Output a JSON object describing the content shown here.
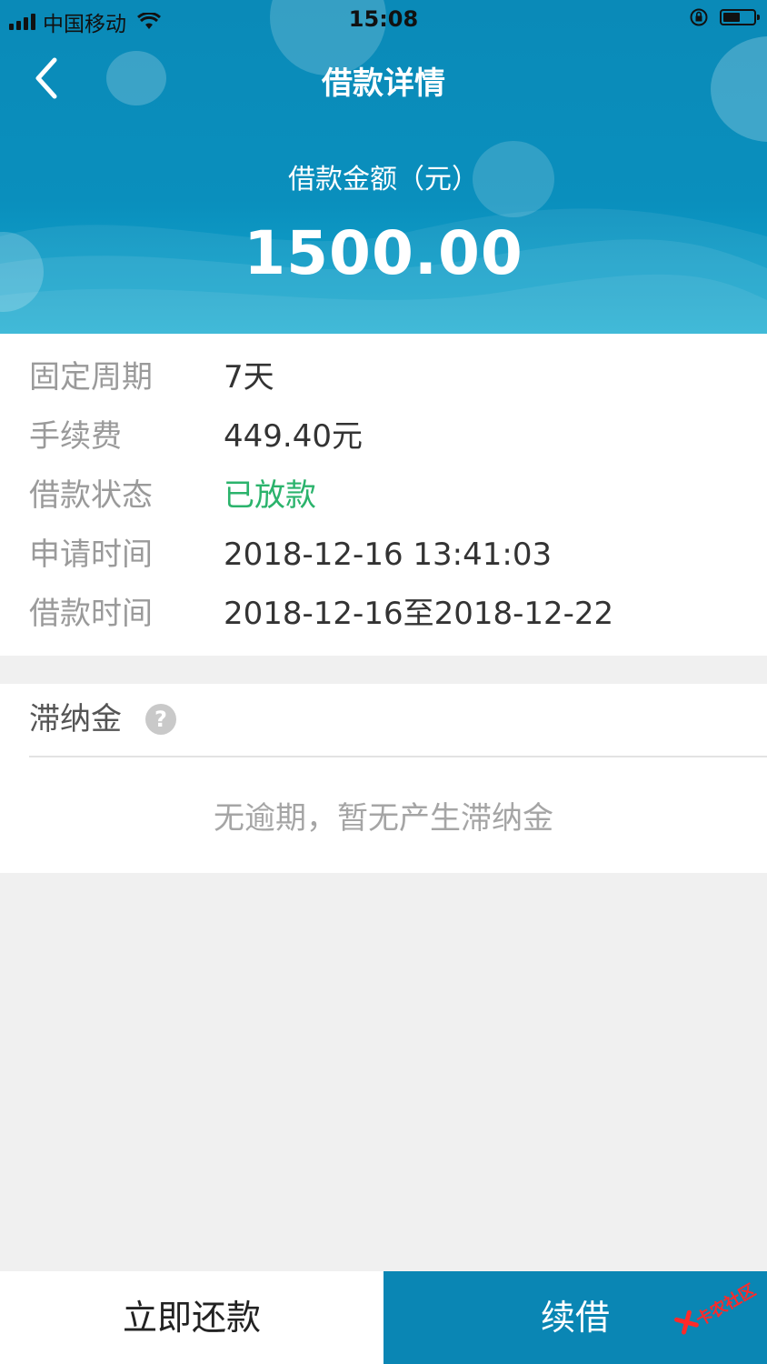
{
  "status_bar": {
    "carrier": "中国移动",
    "time": "15:08"
  },
  "nav": {
    "title": "借款详情"
  },
  "summary": {
    "amount_label": "借款金额（元）",
    "amount_value": "1500.00"
  },
  "details": [
    {
      "label": "固定周期",
      "value": "7天"
    },
    {
      "label": "手续费",
      "value": "449.40元"
    },
    {
      "label": "借款状态",
      "value": "已放款"
    },
    {
      "label": "申请时间",
      "value": "2018-12-16 13:41:03"
    },
    {
      "label": "借款时间",
      "value": "2018-12-16至2018-12-22"
    }
  ],
  "late_fee": {
    "title": "滞纳金",
    "help": "?",
    "message": "无逾期，暂无产生滞纳金"
  },
  "actions": {
    "repay_label": "立即还款",
    "renew_label": "续借"
  },
  "watermark": "卡农社区",
  "colors": {
    "header": "#0a8ab8",
    "status_green": "#2bb36c",
    "renew_button": "#0a86b4"
  }
}
